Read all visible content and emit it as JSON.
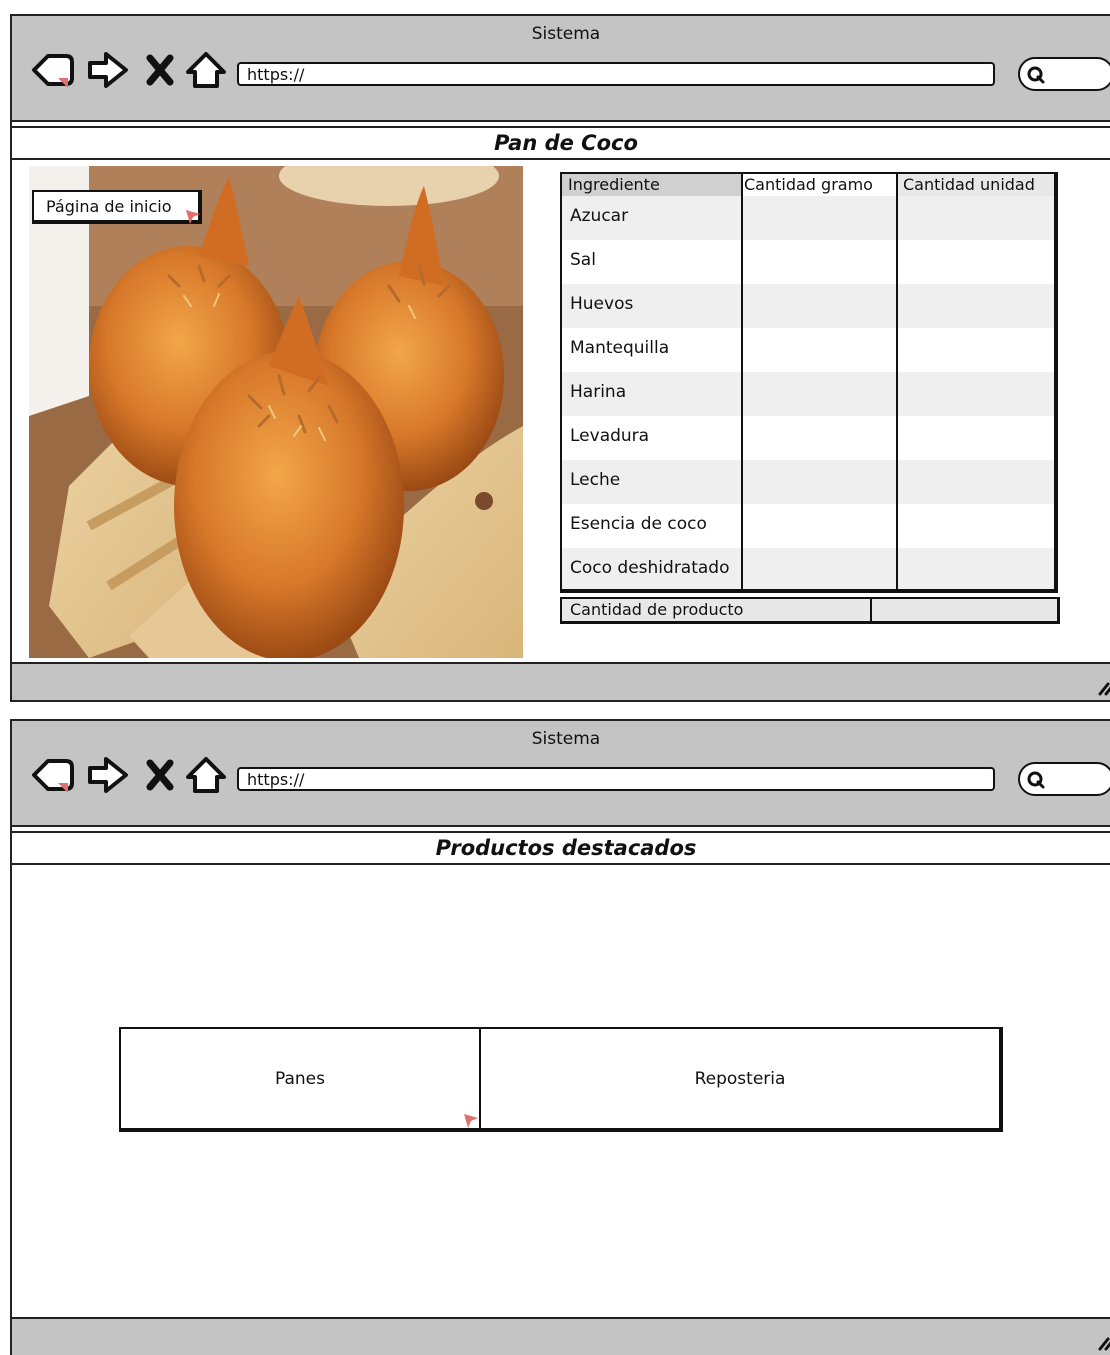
{
  "window1": {
    "title": "Sistema",
    "url": "https://",
    "header": "Pan de Coco",
    "home_button": "Página de inicio",
    "image_icon": "bread-photo",
    "table": {
      "headers": [
        "Ingrediente",
        "Cantidad gramo",
        "Cantidad unidad"
      ],
      "ingredients": [
        "Azucar",
        "Sal",
        "Huevos",
        "Mantequilla",
        "Harina",
        "Levadura",
        "Leche",
        "Esencia de coco",
        "Coco deshidratado"
      ]
    },
    "quantity_label": "Cantidad de producto"
  },
  "window2": {
    "title": "Sistema",
    "url": "https://",
    "header": "Productos destacados",
    "tabs": [
      "Panes",
      "Reposteria"
    ]
  },
  "icons": [
    "back-arrow-icon",
    "forward-arrow-icon",
    "close-x-icon",
    "home-icon",
    "search-icon",
    "resize-grip-icon",
    "cursor-icon"
  ],
  "colors": {
    "chrome": "#c4c4c4",
    "cursor": "#e07070",
    "stroke": "#111111"
  }
}
